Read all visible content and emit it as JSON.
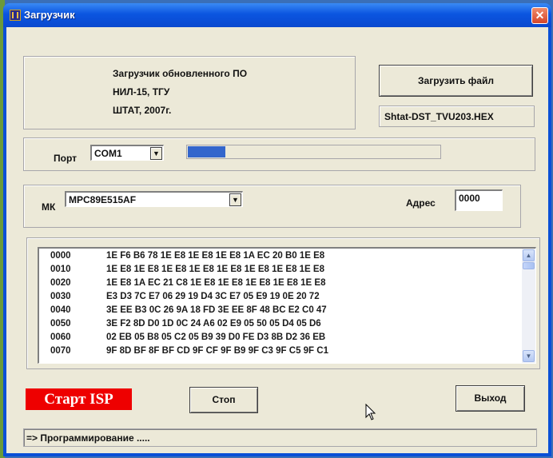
{
  "window": {
    "title": "Загрузчик",
    "close_glyph": "✕"
  },
  "info": {
    "line1": "Загрузчик обновленного ПО",
    "line2": "НИЛ-15, ТГУ",
    "line3": "ШТАТ, 2007г."
  },
  "load_button": "Загрузить файл",
  "file_name": "Shtat-DST_TVU203.HEX",
  "port": {
    "label": "Порт",
    "value": "COM1"
  },
  "progress": {
    "value": 0.15
  },
  "mk": {
    "label": "МК",
    "value": "MPC89E515AF"
  },
  "address": {
    "label": "Адрес",
    "value": "0000"
  },
  "hex_dump": [
    {
      "addr": "0000",
      "bytes": "1E F6 B6 78 1E E8 1E E8 1E E8 1A EC 20 B0 1E E8"
    },
    {
      "addr": "0010",
      "bytes": "1E E8 1E E8 1E E8 1E E8 1E E8 1E E8 1E E8 1E E8"
    },
    {
      "addr": "0020",
      "bytes": "1E E8 1A EC 21 C8 1E E8 1E E8 1E E8 1E E8 1E E8"
    },
    {
      "addr": "0030",
      "bytes": "E3 D3 7C E7 06 29 19 D4 3C E7 05 E9 19 0E 20 72"
    },
    {
      "addr": "0040",
      "bytes": "3E EE B3 0C 26 9A 18 FD 3E EE 8F 48 BC E2 C0 47"
    },
    {
      "addr": "0050",
      "bytes": "3E F2 8D D0 1D 0C 24 A6 02 E9 05 50 05 D4 05 D6"
    },
    {
      "addr": "0060",
      "bytes": "02 EB 05 B8 05 C2 05 B9 39 D0 FE D3 8B D2 36 EB"
    },
    {
      "addr": "0070",
      "bytes": "9F 8D BF 8F BF CD 9F CF 9F B9 9F C3 9F C5 9F C1"
    }
  ],
  "buttons": {
    "start_isp": "Старт ISP",
    "stop": "Стоп",
    "exit": "Выход"
  },
  "status_text": "=> Программирование .....",
  "colors": {
    "title_bar": "#0b55e0",
    "start_isp_bg": "#ee0000",
    "progress_fill": "#3366cc",
    "dialog_bg": "#ece9d8"
  },
  "icons": [
    "app-icon",
    "close-icon",
    "dropdown-arrow-icon",
    "scroll-up-icon",
    "scroll-down-icon",
    "mouse-cursor-icon"
  ]
}
